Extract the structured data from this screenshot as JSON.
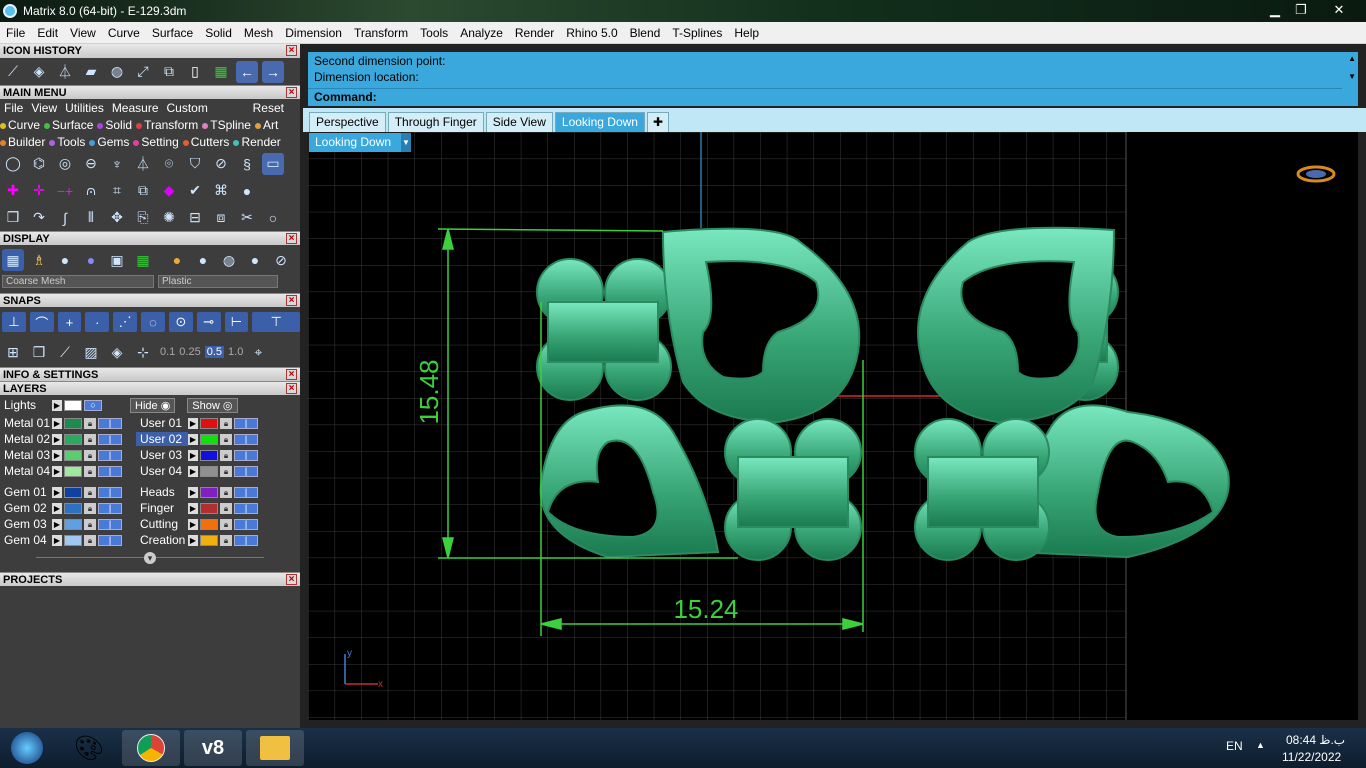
{
  "window": {
    "title": "Matrix 8.0 (64-bit) - E-129.3dm",
    "min": "▁",
    "max": "❐",
    "close": "✕"
  },
  "menubar": [
    "File",
    "Edit",
    "View",
    "Curve",
    "Surface",
    "Solid",
    "Mesh",
    "Dimension",
    "Transform",
    "Tools",
    "Analyze",
    "Render",
    "Rhino 5.0",
    "Blend",
    "T-Splines",
    "Help"
  ],
  "panels": {
    "icon_history": "ICON HISTORY",
    "main_menu": "MAIN MENU",
    "display": "DISPLAY",
    "snaps": "SNAPS",
    "info": "INFO & SETTINGS",
    "layers": "LAYERS",
    "projects": "PROJECTS"
  },
  "main_menu": {
    "items": [
      "File",
      "View",
      "Utilities",
      "Measure",
      "Custom"
    ],
    "reset": "Reset",
    "cats1": [
      {
        "label": "Curve",
        "color": "#e0c020"
      },
      {
        "label": "Surface",
        "color": "#40c040"
      },
      {
        "label": "Solid",
        "color": "#b040e0"
      },
      {
        "label": "Transform",
        "color": "#e04040"
      },
      {
        "label": "TSpline",
        "color": "#e080c0"
      },
      {
        "label": "Art",
        "color": "#e0a040"
      }
    ],
    "cats2": [
      {
        "label": "Builder",
        "color": "#e08030"
      },
      {
        "label": "Tools",
        "color": "#b060e0"
      },
      {
        "label": "Gems",
        "color": "#40a0e0"
      },
      {
        "label": "Setting",
        "color": "#e040a0"
      },
      {
        "label": "Cutters",
        "color": "#e06030"
      },
      {
        "label": "Render",
        "color": "#40c0c0"
      }
    ]
  },
  "display": {
    "mesh": "Coarse Mesh",
    "material": "Plastic"
  },
  "snaps": {
    "values": [
      "0.1",
      "0.25",
      "0.5",
      "1.0"
    ]
  },
  "layers": {
    "lights": "Lights",
    "hide": "Hide",
    "show": "Show",
    "left": [
      {
        "name": "Metal 01",
        "color": "#1e8a50"
      },
      {
        "name": "Metal 02",
        "color": "#2ea860"
      },
      {
        "name": "Metal 03",
        "color": "#5ccc70"
      },
      {
        "name": "Metal 04",
        "color": "#a0e8a0"
      }
    ],
    "right": [
      {
        "name": "User 01",
        "color": "#e01010"
      },
      {
        "name": "User 02",
        "color": "#10e010"
      },
      {
        "name": "User 03",
        "color": "#1010e0"
      },
      {
        "name": "User 04",
        "color": "#909090"
      }
    ],
    "left2": [
      {
        "name": "Gem 01",
        "color": "#1040a0"
      },
      {
        "name": "Gem 02",
        "color": "#3070c0"
      },
      {
        "name": "Gem 03",
        "color": "#60a0e0"
      },
      {
        "name": "Gem 04",
        "color": "#a0c8f0"
      }
    ],
    "right2": [
      {
        "name": "Heads",
        "color": "#8020c0"
      },
      {
        "name": "Finger",
        "color": "#b03030"
      },
      {
        "name": "Cutting",
        "color": "#f07010"
      },
      {
        "name": "Creation",
        "color": "#f0b010"
      }
    ]
  },
  "command": {
    "line1": "Second dimension point:",
    "line2": "Dimension location:",
    "prompt": "Command:"
  },
  "tabs": [
    "Perspective",
    "Through Finger",
    "Side View",
    "Looking Down"
  ],
  "viewport": {
    "label": "Looking Down",
    "dim_vertical": "15.48",
    "dim_horizontal": "15.24",
    "axis_y": "y",
    "axis_x": "x"
  },
  "taskbar": {
    "lang": "EN",
    "time": "08:44 ب.ظ",
    "date": "11/22/2022"
  }
}
